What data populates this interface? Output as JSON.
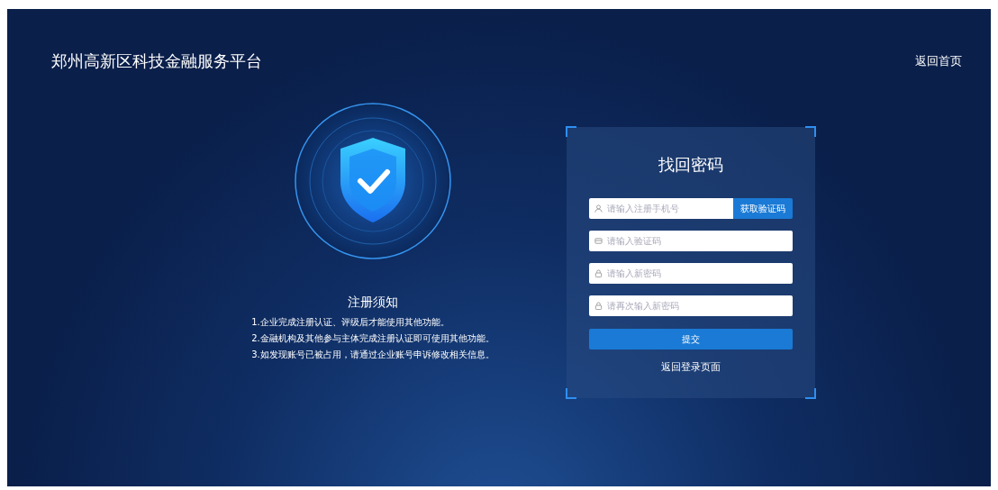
{
  "header": {
    "title": "郑州高新区科技金融服务平台",
    "home_link": "返回首页"
  },
  "notice": {
    "title": "注册须知",
    "items": [
      "1.企业完成注册认证、评级后才能使用其他功能。",
      "2.金融机构及其他参与主体完成注册认证即可使用其他功能。",
      "3.如发现账号已被占用，请通过企业账号申诉修改相关信息。"
    ]
  },
  "form": {
    "title": "找回密码",
    "fields": [
      {
        "kind": "user",
        "placeholder": "请输入注册手机号",
        "button": "获取验证码"
      },
      {
        "kind": "card",
        "placeholder": "请输入验证码"
      },
      {
        "kind": "lock",
        "placeholder": "请输入新密码"
      },
      {
        "kind": "lock",
        "placeholder": "请再次输入新密码"
      }
    ],
    "submit": "提交",
    "back_link": "返回登录页面"
  }
}
